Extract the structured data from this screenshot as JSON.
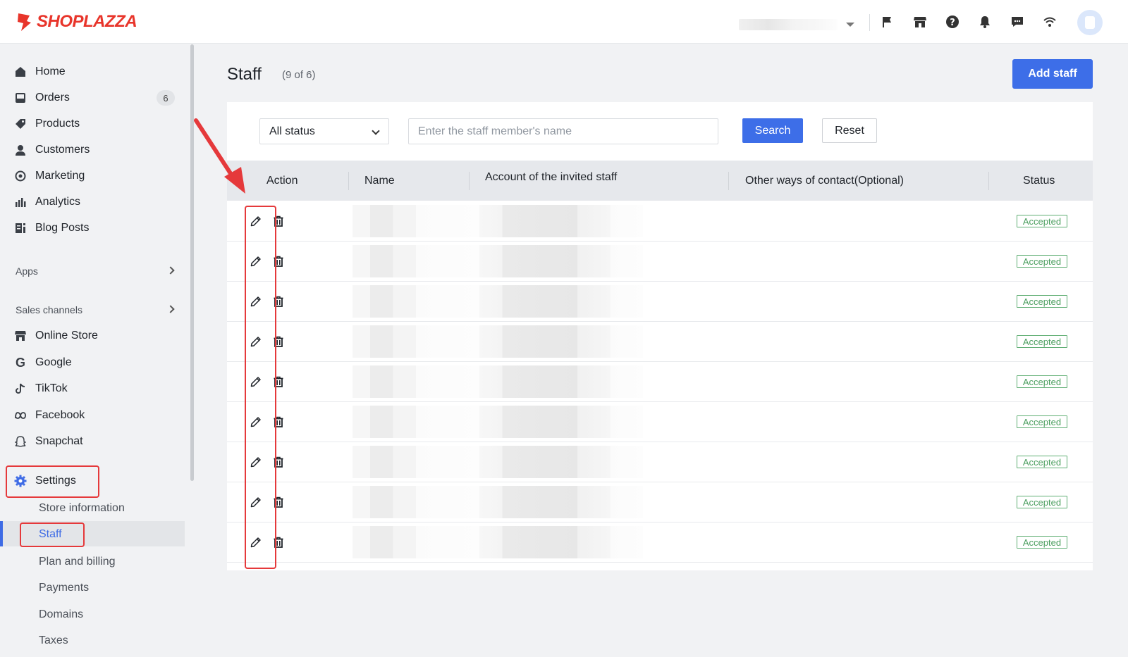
{
  "brand": {
    "name": "SHOPLAZZA",
    "color": "#e8352b"
  },
  "header": {
    "icons": [
      "flag-icon",
      "storefront-icon",
      "help-icon",
      "bell-icon",
      "chat-icon",
      "wifi-icon"
    ]
  },
  "sidebar": {
    "items": [
      {
        "label": "Home",
        "icon": "home-icon"
      },
      {
        "label": "Orders",
        "icon": "inbox-icon",
        "badge": "6"
      },
      {
        "label": "Products",
        "icon": "tag-icon"
      },
      {
        "label": "Customers",
        "icon": "person-icon"
      },
      {
        "label": "Marketing",
        "icon": "target-icon"
      },
      {
        "label": "Analytics",
        "icon": "bar-chart-icon"
      },
      {
        "label": "Blog Posts",
        "icon": "blog-icon"
      }
    ],
    "apps_label": "Apps",
    "sales_channels_label": "Sales channels",
    "channels": [
      {
        "label": "Online Store",
        "icon": "storefront-icon"
      },
      {
        "label": "Google",
        "icon": "google-icon"
      },
      {
        "label": "TikTok",
        "icon": "tiktok-icon"
      },
      {
        "label": "Facebook",
        "icon": "meta-icon"
      },
      {
        "label": "Snapchat",
        "icon": "snapchat-icon"
      }
    ],
    "settings_label": "Settings",
    "settings_sub": [
      "Store information",
      "Staff",
      "Plan and billing",
      "Payments",
      "Domains",
      "Taxes"
    ]
  },
  "main": {
    "title": "Staff",
    "count": "(9 of 6)",
    "add_button": "Add staff",
    "filter": {
      "status_value": "All status",
      "name_placeholder": "Enter the staff member's name",
      "search_label": "Search",
      "reset_label": "Reset"
    },
    "table": {
      "headers": [
        "Action",
        "Name",
        "Account of the invited staff",
        "Other ways of contact(Optional)",
        "Status"
      ],
      "rows": [
        {
          "status": "Accepted"
        },
        {
          "status": "Accepted"
        },
        {
          "status": "Accepted"
        },
        {
          "status": "Accepted"
        },
        {
          "status": "Accepted"
        },
        {
          "status": "Accepted"
        },
        {
          "status": "Accepted"
        },
        {
          "status": "Accepted"
        },
        {
          "status": "Accepted"
        }
      ]
    }
  },
  "colors": {
    "accent": "#3d6ee8",
    "highlight": "#e5393b",
    "status_accepted": "#4a9e5e"
  }
}
